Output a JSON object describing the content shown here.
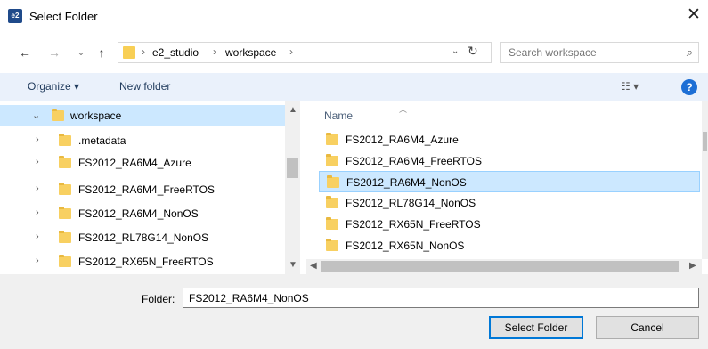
{
  "window": {
    "title": "Select Folder",
    "app_icon_text": "e2"
  },
  "nav": {
    "back": "←",
    "forward": "→",
    "recent": "⌄",
    "up": "↑",
    "refresh": "↻",
    "dropdown": "⌄"
  },
  "address": {
    "crumbs": [
      "e2_studio",
      "workspace"
    ],
    "sep": "›"
  },
  "search": {
    "placeholder": "Search workspace"
  },
  "toolbar": {
    "organize": "Organize ▾",
    "new_folder": "New folder",
    "help": "?"
  },
  "tree": {
    "items": [
      {
        "label": "workspace",
        "expanded": true,
        "selected": true
      },
      {
        "label": ".metadata"
      },
      {
        "label": "FS2012_RA6M4_Azure"
      },
      {
        "label": "FS2012_RA6M4_FreeRTOS"
      },
      {
        "label": "FS2012_RA6M4_NonOS"
      },
      {
        "label": "FS2012_RL78G14_NonOS"
      },
      {
        "label": "FS2012_RX65N_FreeRTOS"
      }
    ]
  },
  "content": {
    "column_name": "Name",
    "items": [
      {
        "label": "FS2012_RA6M4_Azure"
      },
      {
        "label": "FS2012_RA6M4_FreeRTOS"
      },
      {
        "label": "FS2012_RA6M4_NonOS",
        "selected": true
      },
      {
        "label": "FS2012_RL78G14_NonOS"
      },
      {
        "label": "FS2012_RX65N_FreeRTOS"
      },
      {
        "label": "FS2012_RX65N_NonOS"
      }
    ]
  },
  "bottom": {
    "folder_label": "Folder:",
    "folder_value": "FS2012_RA6M4_NonOS",
    "select_button": "Select Folder",
    "cancel_button": "Cancel"
  },
  "colors": {
    "selection": "#cce8ff",
    "toolbar_bg": "#eaf1fb",
    "folder": "#f8d061",
    "accent": "#0078d7"
  }
}
